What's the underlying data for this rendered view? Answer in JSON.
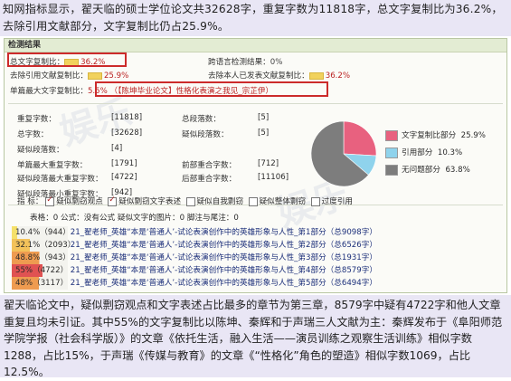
{
  "intro_text": "知网指标显示，翟天临的硕士学位论文共32628字，重复字数为11818字，总文字复制比为36.2%，去除引用文献部分，文字复制比仍占25.9%。",
  "panel": {
    "title": "检测结果",
    "total_copy_label": "总文字复制比：",
    "total_copy_value": "36.2%",
    "cross_lang_label": "跨语言检测结果：",
    "cross_lang_value": "0%",
    "excl_ref_label": "去除引用文献复制比：",
    "excl_ref_value": "25.9%",
    "excl_self_label": "去除本人已发表文献复制比：",
    "excl_self_value": "36.2%",
    "single_max_label": "单篇最大文字复制比：",
    "single_max_value": "5.5%",
    "single_max_source": "（【陈坤毕业论文】性格化表演之我见_宗芷伊）",
    "stats_left": [
      {
        "label": "重复字数：",
        "value": "[11818]"
      },
      {
        "label": "总字数：",
        "value": "[32628]"
      },
      {
        "label": "疑似段落数：",
        "value": "[4]"
      },
      {
        "label": "单篇最大重复字数：",
        "value": "[1791]"
      },
      {
        "label": "疑似段落最大重复字数：",
        "value": "[4722]"
      },
      {
        "label": "疑似段落最小重复字数：",
        "value": "[942]"
      }
    ],
    "stats_right": [
      {
        "label": "总段落数：",
        "value": "[5]"
      },
      {
        "label": "疑似段落数：",
        "value": "[5]"
      },
      {
        "label": "前部重合字数：",
        "value": "[712]"
      },
      {
        "label": "后部重合字数：",
        "value": "[11106]"
      }
    ],
    "legend": [
      {
        "label": "文字复制比部分",
        "value": "25.9%",
        "color": "#e8617f"
      },
      {
        "label": "引用部分",
        "value": "10.3%",
        "color": "#8fd3ec"
      },
      {
        "label": "无问题部分",
        "value": "63.8%",
        "color": "#7d7d7d"
      }
    ],
    "indicator_label": "指  标：",
    "indicators": [
      {
        "label": "疑似剽窃观点",
        "checked": true
      },
      {
        "label": "疑似剽窃文字表述",
        "checked": true
      },
      {
        "label": "疑似自我剽窃",
        "checked": false
      },
      {
        "label": "疑似整体剽窃",
        "checked": false
      },
      {
        "label": "过度引用",
        "checked": false
      }
    ],
    "counts_line": "表格：0    公式：没有公式    疑似文字的图片：0    脚注与尾注：0",
    "chapters": [
      {
        "pct": "10.4%（944）",
        "text": "21_翟老师_英雄“本是‘普通人’-试论表演创作中的英雄形象与人性_第1部分（总9098字）",
        "color": "#f5e06a",
        "w": 0.104
      },
      {
        "pct": "32.1%（2093）",
        "text": "21_翟老师_英雄“本是‘普通人’-试论表演创作中的英雄形象与人性_第2部分（总6526字）",
        "color": "#f3c25a",
        "w": 0.321
      },
      {
        "pct": "48.8%（943）",
        "text": "21_翟老师_英雄“本是‘普通人’-试论表演创作中的英雄形象与人性_第3部分（总1931字）",
        "color": "#ee9b50",
        "w": 0.488
      },
      {
        "pct": "55%（4722）",
        "text": "21_翟老师_英雄“本是‘普通人’-试论表演创作中的英雄形象与人性_第4部分（总8579字）",
        "color": "#e05252",
        "w": 0.55
      },
      {
        "pct": "48%（3117）",
        "text": "21_翟老师_英雄“本是‘普通人’-试论表演创作中的英雄形象与人性_第5部分（总6494字）",
        "color": "#ee9b50",
        "w": 0.48
      }
    ]
  },
  "bottom_text": "翟天临论文中，疑似剽窃观点和文字表述占比最多的章节为第三章，8579字中疑有4722字和他人文章重复且均未引证。其中55%的文字复制比以陈坤、秦辉和于声瑞三人文献为主：秦辉发布于《阜阳师范学院学报（社会科学版）》的文章《依托生活，融入生活——演员训练之观察生活训练》相似字数1288，占比15%，于声瑞《传媒与教育》的文章《“性格化”角色的塑造》相似字数1069，占比12.5%。"
}
